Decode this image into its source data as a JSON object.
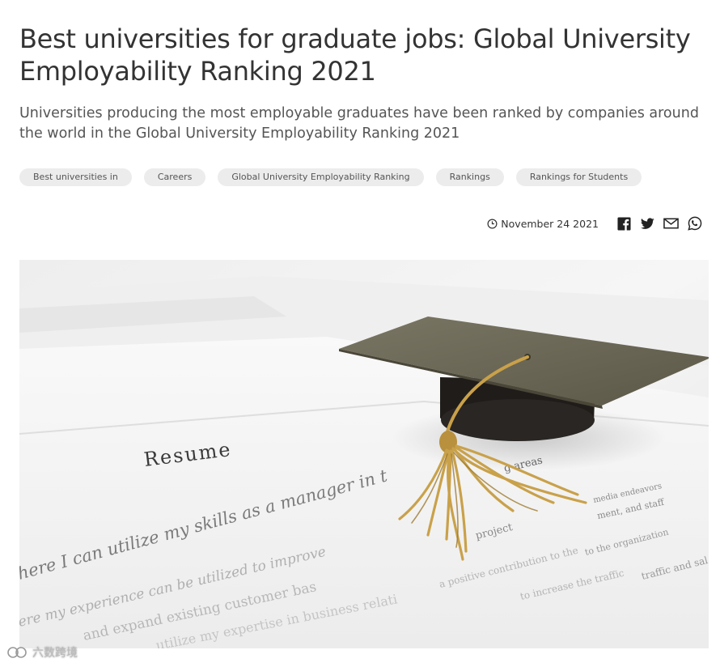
{
  "article": {
    "title": "Best universities for graduate jobs: Global University Employability Ranking 2021",
    "subtitle": "Universities producing the most employable graduates have been ranked by companies around the world in the Global University Employability Ranking 2021",
    "tags": [
      "Best universities in",
      "Careers",
      "Global University Employability Ranking",
      "Rankings",
      "Rankings for Students"
    ],
    "date": "November 24 2021"
  },
  "share": {
    "icons": [
      "facebook-icon",
      "twitter-icon",
      "email-icon",
      "whatsapp-icon"
    ]
  },
  "hero": {
    "heading": "Resume",
    "line1": "here I can utilize my skills as a manager  in t",
    "line1_tail": "g areas",
    "line2": "ere my experience can be utilized to improve",
    "line3": "and expand existing customer bas",
    "line4": "utilize my expertise  in business relati",
    "frag1": "media endeavors",
    "frag2": "ment, and staff",
    "frag3": "to the organization",
    "frag4": "traffic and sal",
    "frag5": "project",
    "frag6": "to increase the traffic",
    "frag7": "a positive contribution to the"
  },
  "watermark": {
    "text": "六数跨境"
  },
  "colors": {
    "title": "#333333",
    "tag_bg": "#ececec",
    "cap_board": "#6e6a5a",
    "tassel": "#c9a14a"
  }
}
